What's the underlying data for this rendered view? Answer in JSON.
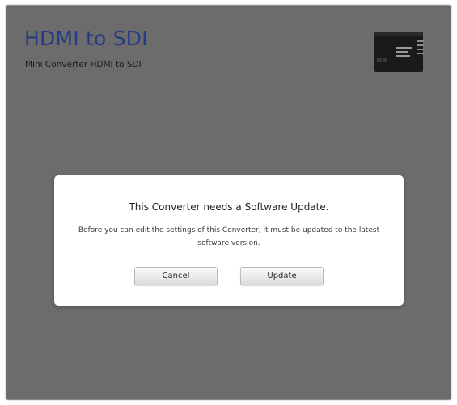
{
  "window": {
    "title": "HDMI to SDI",
    "subtitle": "Mini Converter HDMI to SDI",
    "device_image_icon": "mini-converter-device-image",
    "title_color": "#243c86",
    "background_color": "#6c6c6c"
  },
  "dialog": {
    "heading": "This Converter needs a Software Update.",
    "message": "Before you can edit the settings of this Converter, it must be updated to the latest software version.",
    "cancel_label": "Cancel",
    "update_label": "Update"
  }
}
